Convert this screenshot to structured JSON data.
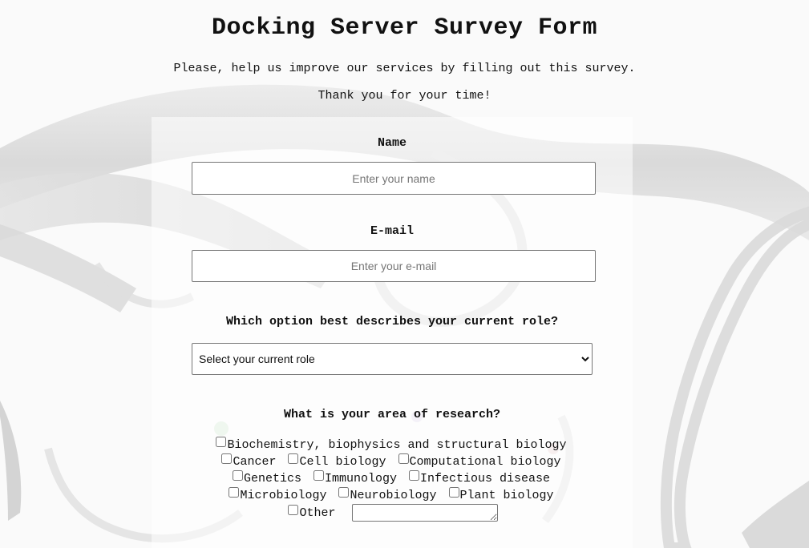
{
  "header": {
    "title": "Docking Server Survey Form",
    "description": "Please, help us improve our services by filling out this survey.",
    "thanks": "Thank you for your time!"
  },
  "form": {
    "name": {
      "label": "Name",
      "placeholder": "Enter your name",
      "value": ""
    },
    "email": {
      "label": "E-mail",
      "placeholder": "Enter your e-mail",
      "value": ""
    },
    "role": {
      "label": "Which option best describes your current role?",
      "selected": "Select your current role"
    },
    "research": {
      "label": "What is your area of research?",
      "options": [
        {
          "label": "Biochemistry, biophysics and structural biology",
          "checked": false
        },
        {
          "label": "Cancer",
          "checked": false
        },
        {
          "label": "Cell biology",
          "checked": false
        },
        {
          "label": "Computational biology",
          "checked": false
        },
        {
          "label": "Genetics",
          "checked": false
        },
        {
          "label": "Immunology",
          "checked": false
        },
        {
          "label": "Infectious disease",
          "checked": false
        },
        {
          "label": "Microbiology",
          "checked": false
        },
        {
          "label": "Neurobiology",
          "checked": false
        },
        {
          "label": "Plant biology",
          "checked": false
        },
        {
          "label": "Other",
          "checked": false
        }
      ],
      "other_value": ""
    }
  },
  "colors": {
    "background": "#fafafa",
    "ribbon": "#dcdcdc",
    "text": "#111111",
    "input_border": "#767676"
  }
}
